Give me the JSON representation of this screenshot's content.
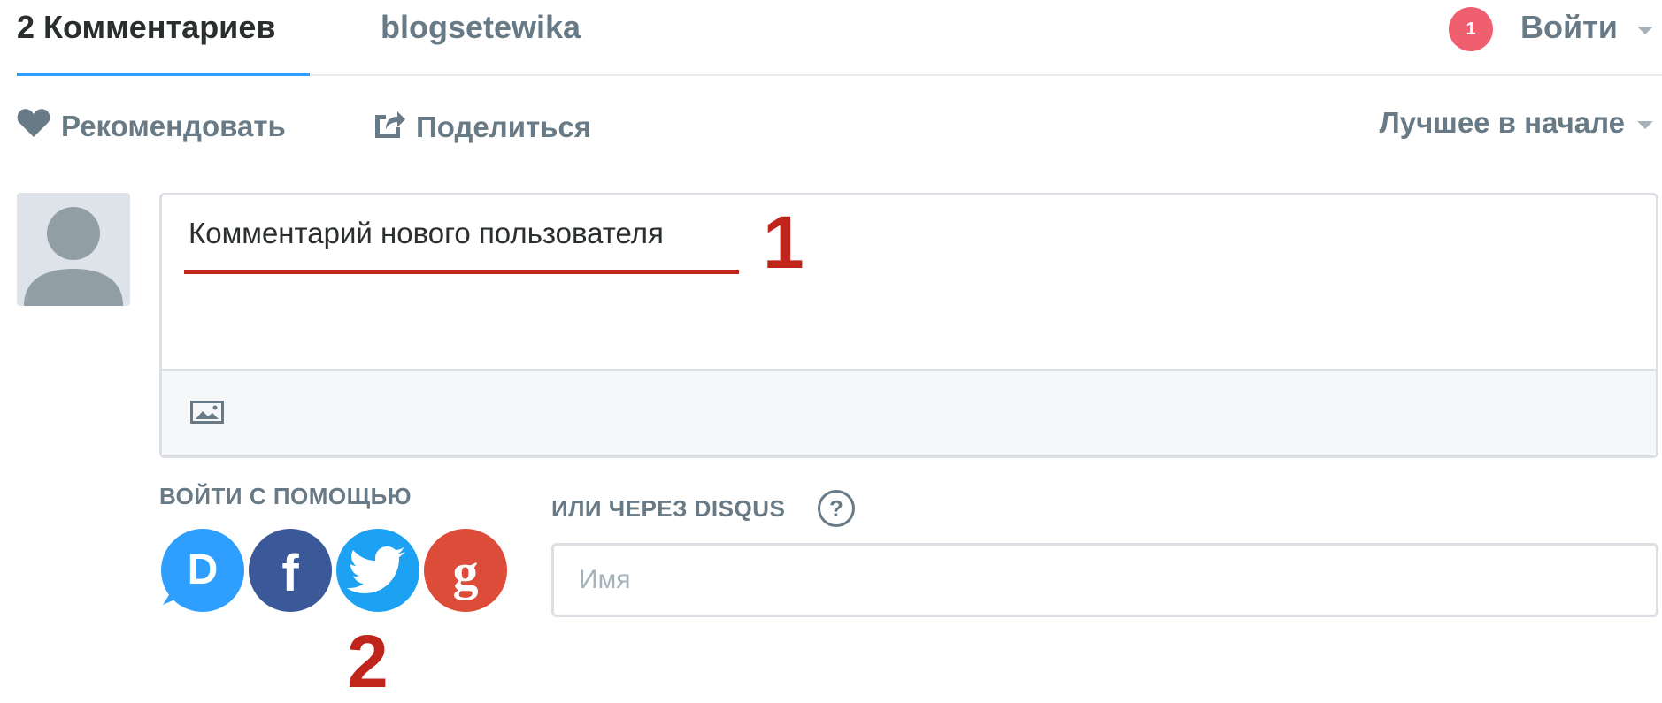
{
  "nav": {
    "comments_tab": "2 Комментариев",
    "forum_tab": "blogsetewika",
    "notification_count": "1",
    "login_label": "Войти"
  },
  "actions": {
    "recommend_label": "Рекомендовать",
    "share_label": "Поделиться",
    "sort_label": "Лучшее в начале"
  },
  "editor": {
    "text": "Комментарий нового пользователя"
  },
  "annotations": {
    "marker_1": "1",
    "marker_2": "2"
  },
  "login": {
    "social_label": "ВОЙТИ С ПОМОЩЬЮ",
    "disqus_label": "ИЛИ ЧЕРЕЗ DISQUS",
    "help_glyph": "?",
    "name_placeholder": "Имя",
    "providers": [
      "disqus",
      "facebook",
      "twitter",
      "google"
    ]
  },
  "colors": {
    "accent_blue": "#2e9fff",
    "annotation_red": "#c0251b",
    "badge_red": "#f05f70",
    "disqus": "#2e9fff",
    "facebook": "#3b5998",
    "twitter": "#1da1f2",
    "google": "#dd4b39"
  }
}
